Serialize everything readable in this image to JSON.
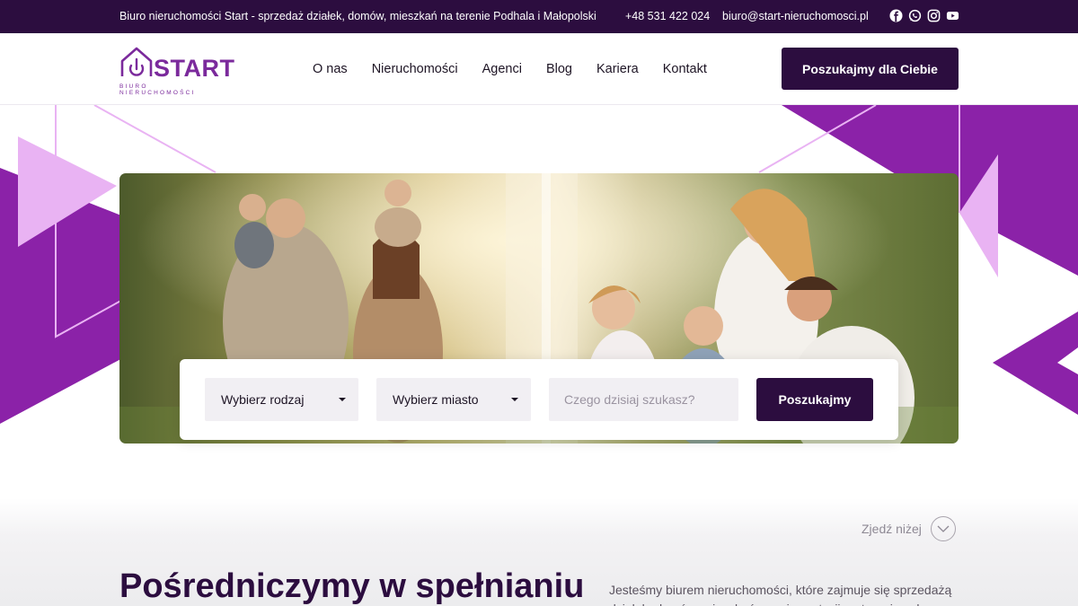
{
  "topbar": {
    "tagline": "Biuro nieruchomości Start - sprzedaż działek, domów, mieszkań na terenie Podhala i Małopolski",
    "phone": "+48 531 422 024",
    "email": "biuro@start-nieruchomosci.pl",
    "socials": [
      "facebook-icon",
      "whatsapp-icon",
      "instagram-icon",
      "youtube-icon"
    ]
  },
  "header": {
    "logo_word": "START",
    "logo_sub": "BIURO NIERUCHOMOŚCI",
    "nav": [
      "O nas",
      "Nieruchomości",
      "Agenci",
      "Blog",
      "Kariera",
      "Kontakt"
    ],
    "cta": "Poszukajmy dla Ciebie"
  },
  "search": {
    "type_select": "Wybierz rodzaj",
    "city_select": "Wybierz miasto",
    "query_placeholder": "Czego dzisiaj szukasz?",
    "submit": "Poszukajmy"
  },
  "section": {
    "scroll_label": "Zjedź niżej",
    "heading": "Pośredniczymy w spełnianiu",
    "paragraph": "Jesteśmy biurem nieruchomości, które zajmuje się sprzedażą działek, domów, mieszkań oraz inwestycji na terenie całego"
  },
  "colors": {
    "brand_dark": "#2c0d3f",
    "brand_purple": "#8b22a8",
    "light_purple": "#e9b3f3"
  }
}
